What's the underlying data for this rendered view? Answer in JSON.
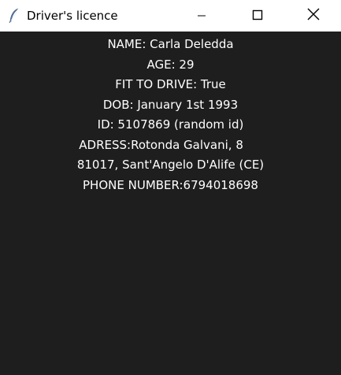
{
  "window": {
    "title": "Driver's licence",
    "icon": "feather-icon",
    "controls": [
      "minimize-icon",
      "maximize-icon",
      "close-icon"
    ]
  },
  "licence": {
    "lines": [
      "NAME: Carla Deledda",
      "AGE: 29",
      "FIT TO DRIVE: True",
      "DOB: January 1st 1993",
      "ID: 5107869 (random id)",
      "ADRESS:Rotonda Galvani, 8     ",
      "81017, Sant'Angelo D'Alife (CE)",
      "PHONE NUMBER:6794018698"
    ]
  },
  "colors": {
    "background": "#1e1e1e",
    "text": "#ffffff",
    "titlebar": "#ffffff"
  }
}
